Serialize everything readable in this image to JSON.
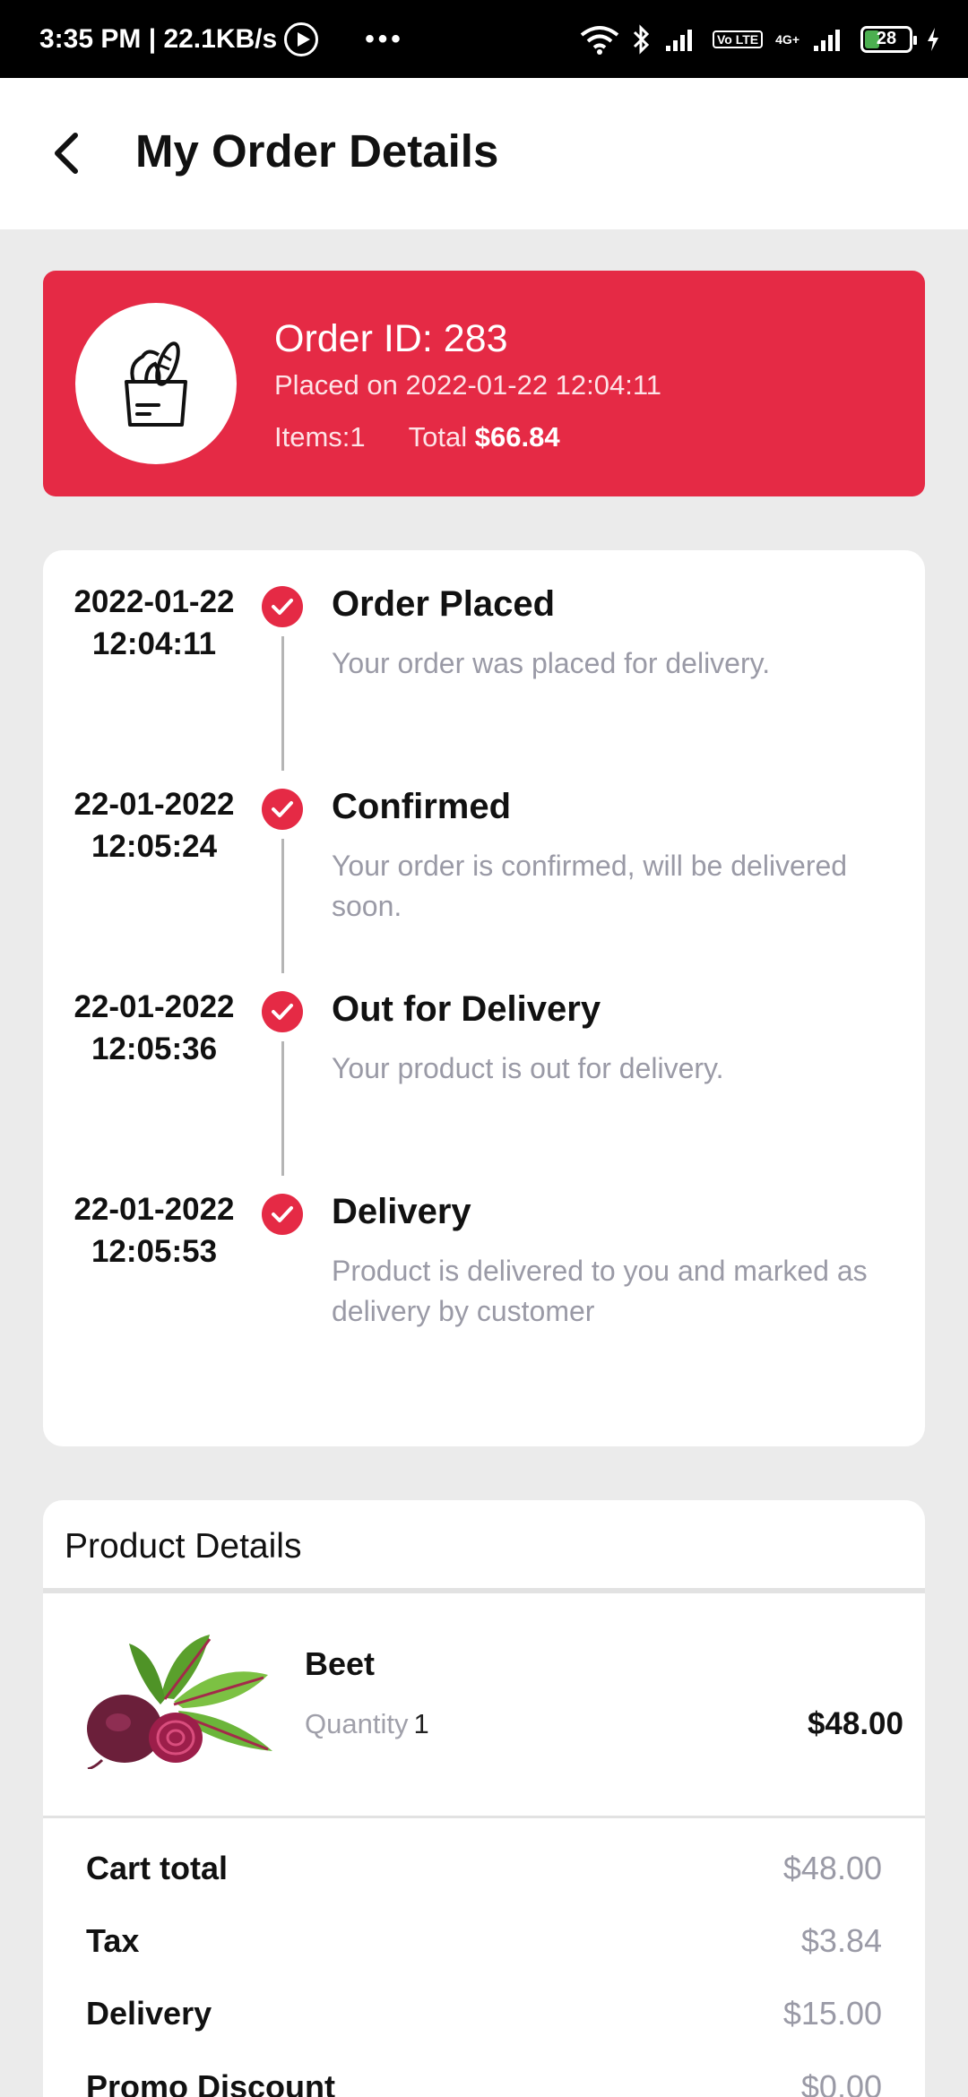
{
  "status_bar": {
    "time_speed": "3:35 PM | 22.1KB/s",
    "dots": "•••",
    "net_label": "4G+",
    "volte_label": "Vo LTE",
    "battery": "28"
  },
  "header": {
    "title": "My Order Details"
  },
  "order": {
    "id_text": "Order ID: 283",
    "placed_label": "Placed on  2022-01-22 12:04:11",
    "items_label": "Items:1",
    "total_label": "Total ",
    "total_value": "$66.84"
  },
  "timeline": [
    {
      "date": "2022-01-22",
      "time": "12:04:11",
      "title": "Order Placed",
      "desc": "Your order was placed for delivery."
    },
    {
      "date": "22-01-2022",
      "time": "12:05:24",
      "title": "Confirmed",
      "desc": "Your order is confirmed, will be delivered soon."
    },
    {
      "date": "22-01-2022",
      "time": "12:05:36",
      "title": "Out for Delivery",
      "desc": "Your product is out for delivery."
    },
    {
      "date": "22-01-2022",
      "time": "12:05:53",
      "title": "Delivery",
      "desc": "Product is delivered to you and marked as delivery by customer"
    }
  ],
  "product_details": {
    "heading": "Product Details",
    "product": {
      "name": "Beet",
      "quantity_label": "Quantity",
      "quantity": "1",
      "price": "$48.00"
    },
    "summary": [
      {
        "label": "Cart total",
        "value": "$48.00"
      },
      {
        "label": "Tax",
        "value": "$3.84"
      },
      {
        "label": "Delivery",
        "value": "$15.00"
      },
      {
        "label": "Promo Discount",
        "value": "$0.00"
      }
    ]
  },
  "colors": {
    "accent": "#e52a45",
    "muted_text": "#9a9aa6"
  }
}
